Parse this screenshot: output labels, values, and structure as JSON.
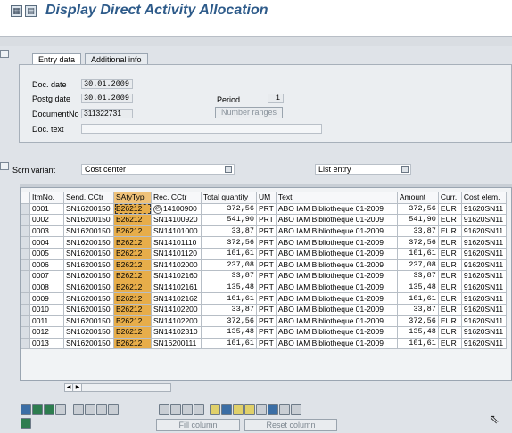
{
  "window": {
    "title": "Display Direct Activity Allocation"
  },
  "tabs": [
    {
      "label": "Entry data",
      "active": true
    },
    {
      "label": "Additional info",
      "active": false
    }
  ],
  "header": {
    "doc_date_label": "Doc. date",
    "doc_date": "30.01.2009",
    "postg_date_label": "Postg date",
    "postg_date": "30.01.2009",
    "period_label": "Period",
    "period": "1",
    "document_no_label": "DocumentNo",
    "document_no": "311322731",
    "number_ranges_label": "Number ranges",
    "doc_text_label": "Doc. text",
    "doc_text": ""
  },
  "selector": {
    "scrn_variant_label": "Scrn variant",
    "scrn_variant_value": "Cost center",
    "list_entry_value": "List entry"
  },
  "table": {
    "columns": [
      "ItmNo.",
      "Send. CCtr",
      "SAtyTyp",
      "Rec. CCtr",
      "Total quantity",
      "UM",
      "Text",
      "Amount",
      "Curr.",
      "Cost elem."
    ],
    "rows": [
      [
        "0001",
        "SN16200150",
        "B26212",
        "14100900",
        "372,56",
        "PRT",
        "ABO IAM Bibliotheque 01-2009",
        "372,56",
        "EUR",
        "91620SN11"
      ],
      [
        "0002",
        "SN16200150",
        "B26212",
        "SN14100920",
        "541,90",
        "PRT",
        "ABO IAM Bibliotheque 01-2009",
        "541,90",
        "EUR",
        "91620SN11"
      ],
      [
        "0003",
        "SN16200150",
        "B26212",
        "SN14101000",
        "33,87",
        "PRT",
        "ABO IAM Bibliotheque 01-2009",
        "33,87",
        "EUR",
        "91620SN11"
      ],
      [
        "0004",
        "SN16200150",
        "B26212",
        "SN14101110",
        "372,56",
        "PRT",
        "ABO IAM Bibliotheque 01-2009",
        "372,56",
        "EUR",
        "91620SN11"
      ],
      [
        "0005",
        "SN16200150",
        "B26212",
        "SN14101120",
        "101,61",
        "PRT",
        "ABO IAM Bibliotheque 01-2009",
        "101,61",
        "EUR",
        "91620SN11"
      ],
      [
        "0006",
        "SN16200150",
        "B26212",
        "SN14102000",
        "237,08",
        "PRT",
        "ABO IAM Bibliotheque 01-2009",
        "237,08",
        "EUR",
        "91620SN11"
      ],
      [
        "0007",
        "SN16200150",
        "B26212",
        "SN14102160",
        "33,87",
        "PRT",
        "ABO IAM Bibliotheque 01-2009",
        "33,87",
        "EUR",
        "91620SN11"
      ],
      [
        "0008",
        "SN16200150",
        "B26212",
        "SN14102161",
        "135,48",
        "PRT",
        "ABO IAM Bibliotheque 01-2009",
        "135,48",
        "EUR",
        "91620SN11"
      ],
      [
        "0009",
        "SN16200150",
        "B26212",
        "SN14102162",
        "101,61",
        "PRT",
        "ABO IAM Bibliotheque 01-2009",
        "101,61",
        "EUR",
        "91620SN11"
      ],
      [
        "0010",
        "SN16200150",
        "B26212",
        "SN14102200",
        "33,87",
        "PRT",
        "ABO IAM Bibliotheque 01-2009",
        "33,87",
        "EUR",
        "91620SN11"
      ],
      [
        "0011",
        "SN16200150",
        "B26212",
        "SN14102200",
        "372,56",
        "PRT",
        "ABO IAM Bibliotheque 01-2009",
        "372,56",
        "EUR",
        "91620SN11"
      ],
      [
        "0012",
        "SN16200150",
        "B26212",
        "SN14102310",
        "135,48",
        "PRT",
        "ABO IAM Bibliotheque 01-2009",
        "135,48",
        "EUR",
        "91620SN11"
      ],
      [
        "0013",
        "SN16200150",
        "B26212",
        "SN16200111",
        "101,61",
        "PRT",
        "ABO IAM Bibliotheque 01-2009",
        "101,61",
        "EUR",
        "91620SN11"
      ]
    ]
  },
  "bottom": {
    "fill_column_label": "Fill column",
    "reset_column_label": "Reset column"
  },
  "colors": {
    "title": "#2e5b8a",
    "highlight_column": "#e7ad4a",
    "background": "#dfe3e8"
  }
}
